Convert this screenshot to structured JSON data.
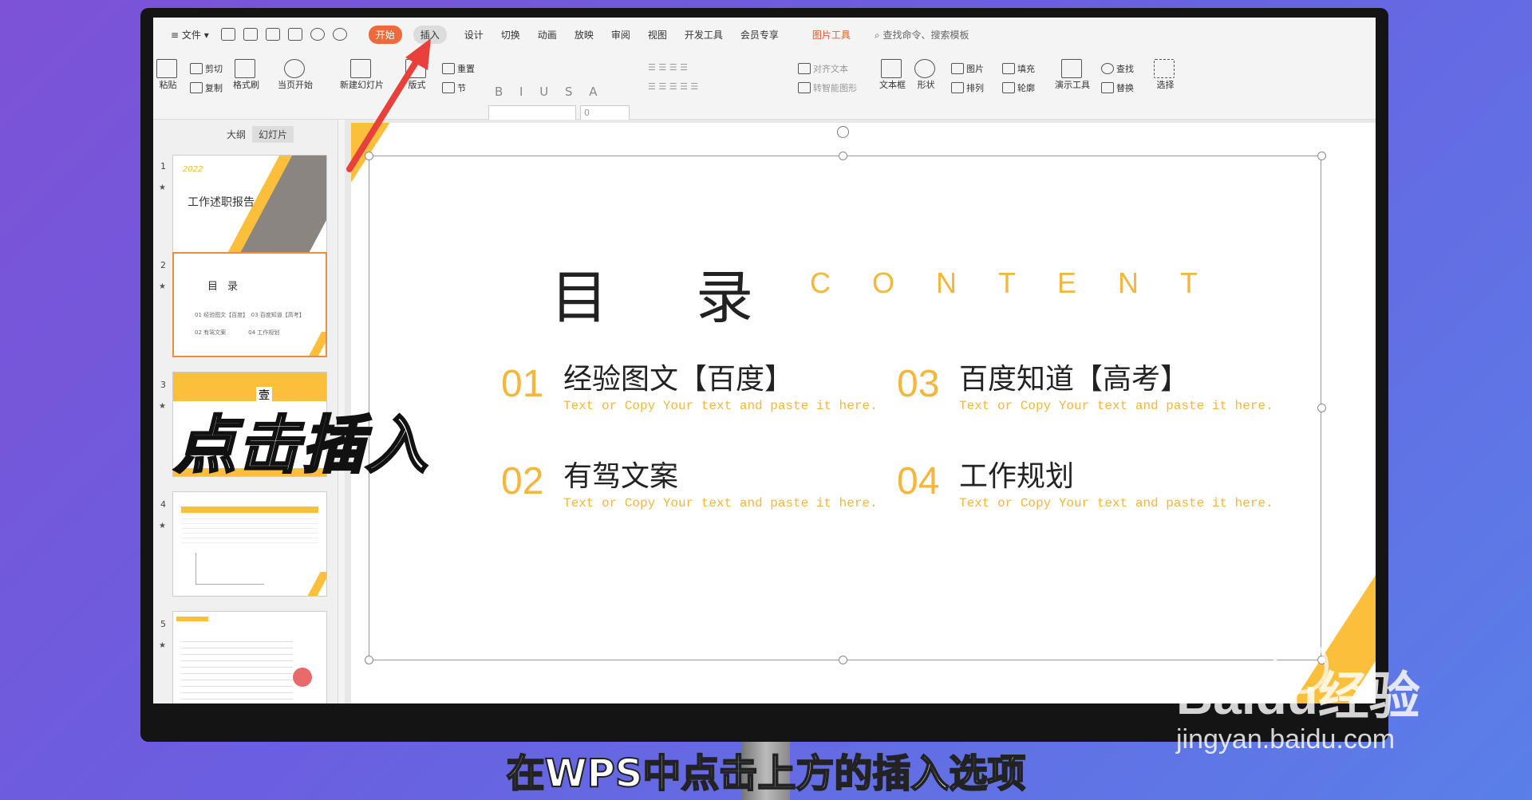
{
  "menubar": {
    "file": "文件",
    "tabs": [
      "开始",
      "插入",
      "设计",
      "切换",
      "动画",
      "放映",
      "审阅",
      "视图",
      "开发工具",
      "会员专享"
    ],
    "picture_tools": "图片工具",
    "search": "查找命令、搜索模板"
  },
  "ribbon": {
    "paste": "粘贴",
    "cut": "剪切",
    "copy": "复制",
    "format_painter": "格式刷",
    "from_current": "当页开始",
    "new_slide": "新建幻灯片",
    "layout": "版式",
    "reset": "重置",
    "section": "节",
    "font_size": "0",
    "align_text": "对齐文本",
    "smart_graphic": "转智能图形",
    "textbox": "文本框",
    "shape": "形状",
    "picture": "图片",
    "arrange": "排列",
    "fill": "填充",
    "outline": "轮廓",
    "present_tools": "演示工具",
    "find": "查找",
    "replace": "替换",
    "select": "选择"
  },
  "sidebar": {
    "tab_outline": "大纲",
    "tab_slides": "幻灯片",
    "slide_numbers": [
      "1",
      "2",
      "3",
      "4",
      "5"
    ],
    "thumb1_year": "2022",
    "thumb1_title": "工作述职报告",
    "thumb3_label": "壹"
  },
  "slide": {
    "title_cn": "目录",
    "title_en": "CONTENT",
    "items": [
      {
        "num": "01",
        "head": "经验图文【百度】",
        "sub": "Text or Copy Your text and  paste it here."
      },
      {
        "num": "02",
        "head": "有驾文案",
        "sub": "Text or Copy Your text and  paste it here."
      },
      {
        "num": "03",
        "head": "百度知道【高考】",
        "sub": "Text or Copy Your text and  paste it here."
      },
      {
        "num": "04",
        "head": "工作规划",
        "sub": "Text or Copy Your text and  paste it here."
      }
    ]
  },
  "overlay": {
    "text": "点击插入"
  },
  "caption": {
    "text": "在WPS中点击上方的插入选项"
  },
  "watermark": {
    "brand": "Baidu经验",
    "url": "jingyan.baidu.com"
  },
  "colors": {
    "accent": "#f4b63d",
    "start_tab": "#ee6a3a",
    "arrow": "#e8403a"
  }
}
